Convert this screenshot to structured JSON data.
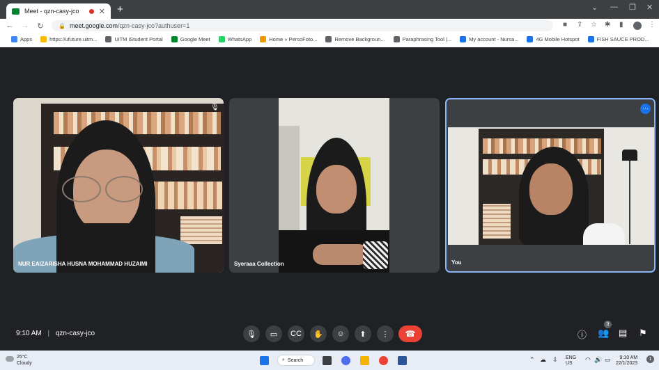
{
  "browser": {
    "tab_title": "Meet - qzn-casy-jco",
    "url_host": "meet.google.com",
    "url_path": "/qzn-casy-jco?authuser=1",
    "bookmarks": [
      {
        "label": "Apps",
        "color": "#4285f4"
      },
      {
        "label": "https://ufuture.uitm...",
        "color": "#fbbc04"
      },
      {
        "label": "UiTM iStudent Portal",
        "color": "#5f6368"
      },
      {
        "label": "Google Meet",
        "color": "#00832d"
      },
      {
        "label": "WhatsApp",
        "color": "#25d366"
      },
      {
        "label": "Home » PersoFoto...",
        "color": "#f29900"
      },
      {
        "label": "Remove Backgroun...",
        "color": "#5f6368"
      },
      {
        "label": "Paraphrasing Tool |...",
        "color": "#5f6368"
      },
      {
        "label": "My account - Nursa...",
        "color": "#1a73e8"
      },
      {
        "label": "4G Mobile Hotspot",
        "color": "#1a73e8"
      },
      {
        "label": "FISH SAUCE PROD...",
        "color": "#1a73e8"
      }
    ]
  },
  "participants": [
    {
      "name": "NUR EAIZARISHA HUSNA MOHAMMAD HUZAIMI"
    },
    {
      "name": "Syeraaa Collection"
    },
    {
      "name": "You"
    }
  ],
  "meeting": {
    "time": "9:10 AM",
    "separator": "|",
    "code": "qzn-casy-jco",
    "people_count": "3",
    "accent": "#8ab4f8",
    "end_color": "#ea4335"
  },
  "taskbar": {
    "temperature": "25°C",
    "weather": "Cloudy",
    "search_label": "Search",
    "lang_top": "ENG",
    "lang_bottom": "US",
    "clock_time": "9:10 AM",
    "clock_date": "22/1/2023"
  }
}
